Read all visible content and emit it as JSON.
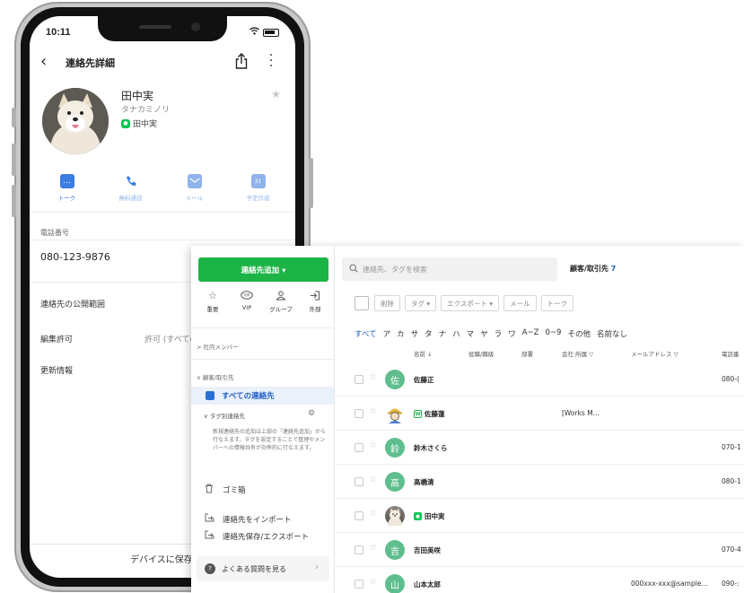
{
  "phone": {
    "status_time": "10:11",
    "nav_title": "連絡先詳細",
    "contact": {
      "name": "田中実",
      "kana": "タナカミノリ",
      "line_name": "田中実"
    },
    "actions": [
      {
        "label": "トーク",
        "icon": "chat-icon",
        "color": "#3b7de0"
      },
      {
        "label": "無料通話",
        "icon": "phone-icon",
        "color": "#3b7de0"
      },
      {
        "label": "メール",
        "icon": "mail-icon",
        "color": "#8fb3ea"
      },
      {
        "label": "予定作成",
        "icon": "calendar-icon",
        "color": "#8fb3ea"
      }
    ],
    "phone_label": "電話番号",
    "phone_value": "080-123-9876",
    "visibility_label": "連絡先の公開範囲",
    "edit_permission_label": "編集許可",
    "edit_permission_value": "許可 (すべての",
    "update_info_label": "更新情報",
    "save_label": "デバイスに保存"
  },
  "app": {
    "add_contact_label": "連絡先追加 ▾",
    "quick": [
      {
        "label": "重要",
        "icon": "star-outline-icon"
      },
      {
        "label": "VIP",
        "icon": "vip-icon"
      },
      {
        "label": "グループ",
        "icon": "group-icon"
      },
      {
        "label": "外部",
        "icon": "external-icon"
      }
    ],
    "internal_members": "> 社内メンバー",
    "customers_section": "∨ 顧客/取引先",
    "all_contacts": "すべての連絡先",
    "tag_section": "∨ タグ別連絡先",
    "tag_description": "新規連絡先の追加は上部の「連絡先追加」から行なえます。タグを設定することで管理やメンバーへの情報共有が効率的に行なえます。",
    "trash": "ゴミ箱",
    "import": "連絡先をインポート",
    "export": "連絡先保存/エクスポート",
    "faq": "よくある質問を見る",
    "search_placeholder": "連絡先、タグを検索",
    "list_title": "顧客/取引先",
    "list_count": "7",
    "toolbar": [
      "削除",
      "タグ ▾",
      "エクスポート ▾",
      "メール",
      "トーク"
    ],
    "index": [
      "すべて",
      "ア",
      "カ",
      "サ",
      "タ",
      "ナ",
      "ハ",
      "マ",
      "ヤ",
      "ラ",
      "ワ",
      "A~Z",
      "0~9",
      "その他",
      "名前なし"
    ],
    "columns": {
      "name": "名前 ↓",
      "title": "役職/職級",
      "department": "部署",
      "company": "会社·所属 ▽",
      "email": "メールアドレス ▽",
      "phone": "電話番"
    },
    "rows": [
      {
        "avatar": "佐",
        "name": "佐藤正",
        "company": "",
        "email": "",
        "phone": "080-("
      },
      {
        "avatar": "",
        "name": "佐藤蓮",
        "company": "[Works M...",
        "email": "",
        "phone": ""
      },
      {
        "avatar": "鈴",
        "name": "鈴木さくら",
        "company": "",
        "email": "",
        "phone": "070-1"
      },
      {
        "avatar": "高",
        "name": "高橋清",
        "company": "",
        "email": "",
        "phone": "080-1"
      },
      {
        "avatar": "",
        "name": "田中実",
        "company": "",
        "email": "",
        "phone": ""
      },
      {
        "avatar": "吉",
        "name": "吉田美咲",
        "company": "",
        "email": "",
        "phone": "070-4"
      },
      {
        "avatar": "山",
        "name": "山本太郎",
        "company": "",
        "email": "000xxx-xxx@sample...",
        "phone": "090-:"
      }
    ]
  },
  "colors": {
    "green": "#1db446",
    "line_green": "#06c755",
    "blue": "#1f5fc4",
    "avatar_green": "#5fbe8e"
  }
}
